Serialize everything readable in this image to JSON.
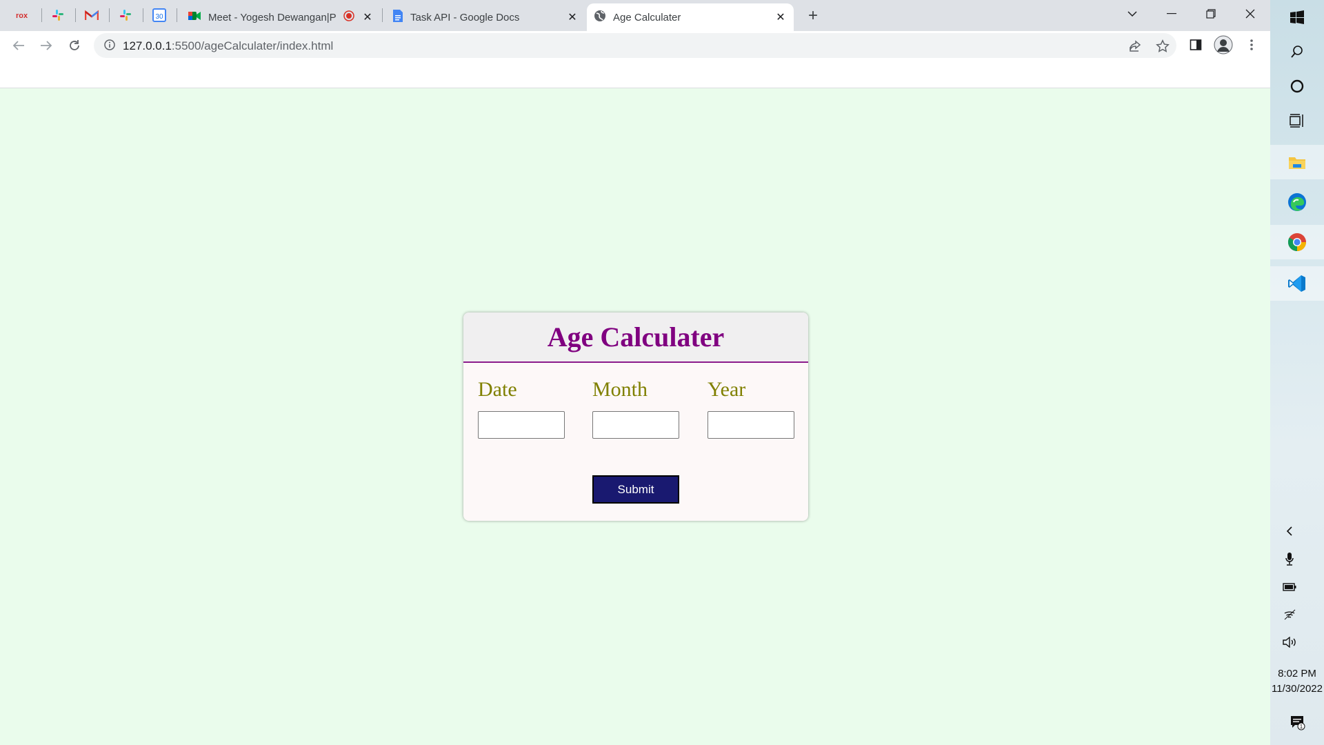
{
  "browser": {
    "tabs": [
      {
        "title": "Meet - Yogesh Dewangan|Pla",
        "active": false,
        "recording": true
      },
      {
        "title": "Task API - Google Docs",
        "active": false
      },
      {
        "title": "Age Calculater",
        "active": true
      }
    ],
    "pinned_tabs": [
      "rox-icon",
      "slack-icon",
      "gmail-icon",
      "slack-icon",
      "google-calendar-icon"
    ],
    "calendar_day": "30",
    "url_host": "127.0.0.1",
    "url_path": ":5500/ageCalculater/index.html"
  },
  "page": {
    "title": "Age Calculater",
    "fields": [
      {
        "label": "Date",
        "value": ""
      },
      {
        "label": "Month",
        "value": ""
      },
      {
        "label": "Year",
        "value": ""
      }
    ],
    "submit_label": "Submit",
    "colors": {
      "background": "#eafcec",
      "title": "#800080",
      "labels": "#808000",
      "submit_bg": "#191970"
    }
  },
  "taskbar": {
    "apps": [
      "windows-start",
      "search",
      "cortana",
      "task-view",
      "file-explorer",
      "edge",
      "chrome",
      "vscode"
    ],
    "time": "8:02 PM",
    "date": "11/30/2022",
    "notification_count": "1"
  }
}
